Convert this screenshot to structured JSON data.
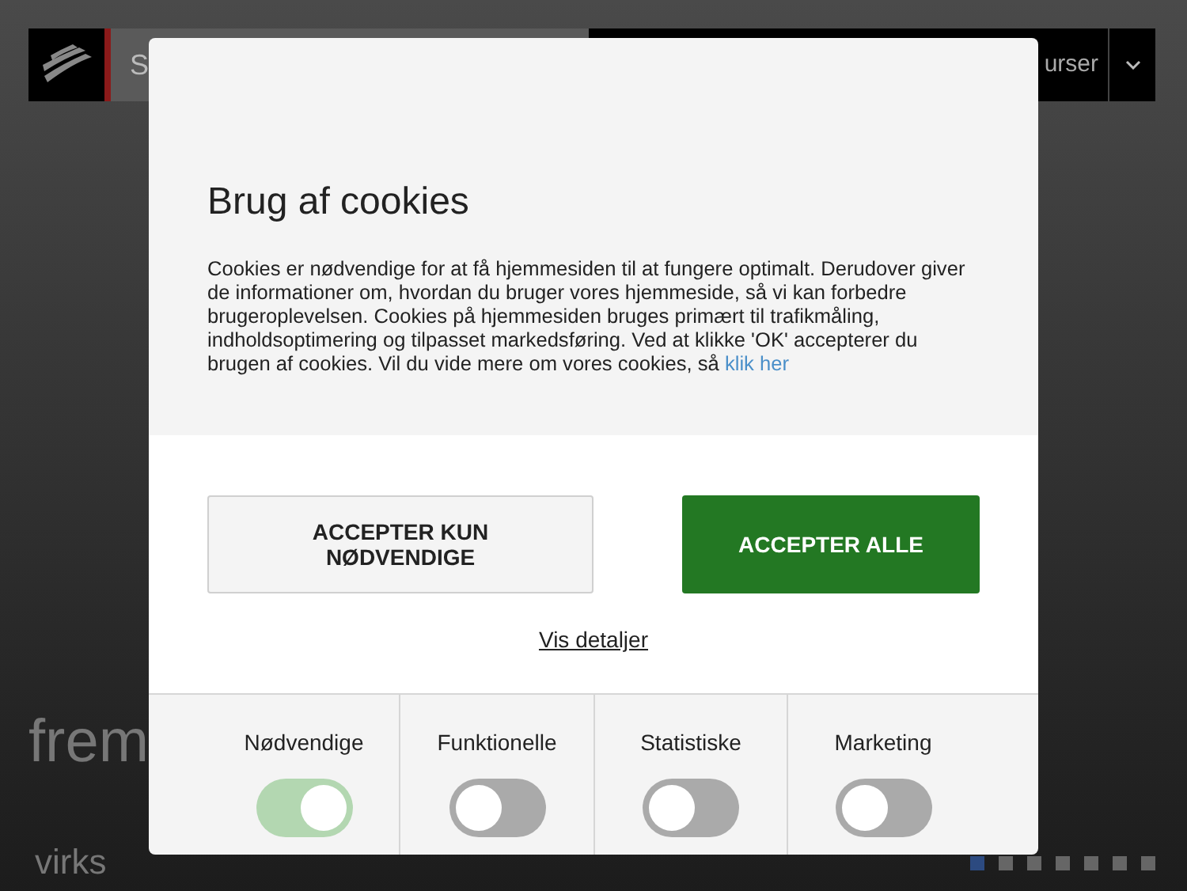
{
  "background": {
    "search_text": "S",
    "nav_text": "urser",
    "hero_heading": "frem",
    "hero_subheading": "virks",
    "slider_dots": [
      {
        "selected": true
      },
      {
        "selected": false
      },
      {
        "selected": false
      },
      {
        "selected": false
      },
      {
        "selected": false
      },
      {
        "selected": false
      },
      {
        "selected": false
      }
    ]
  },
  "dialog": {
    "title": "Brug af cookies",
    "body": "Cookies er nødvendige for at få hjemmesiden til at fungere optimalt. Derudover giver de informationer om, hvordan du bruger vores hjemmeside, så vi kan forbedre brugeroplevelsen. Cookies på hjemmesiden bruges primært til trafikmåling, indholdsoptimering og tilpasset markedsføring. Ved at klikke 'OK' accepterer du brugen af cookies. Vil du vide mere om vores cookies, så",
    "link": "klik her",
    "buttons": [
      {
        "label": "ACCEPTER KUN NØDVENDIGE",
        "kind": "secondary"
      },
      {
        "label": "ACCEPTER ALLE",
        "kind": "primary"
      }
    ],
    "details_link": "Vis detaljer",
    "categories": [
      {
        "label": "Nødvendige",
        "on": true
      },
      {
        "label": "Funktionelle",
        "on": false
      },
      {
        "label": "Statistiske",
        "on": false
      },
      {
        "label": "Marketing",
        "on": false
      }
    ]
  }
}
